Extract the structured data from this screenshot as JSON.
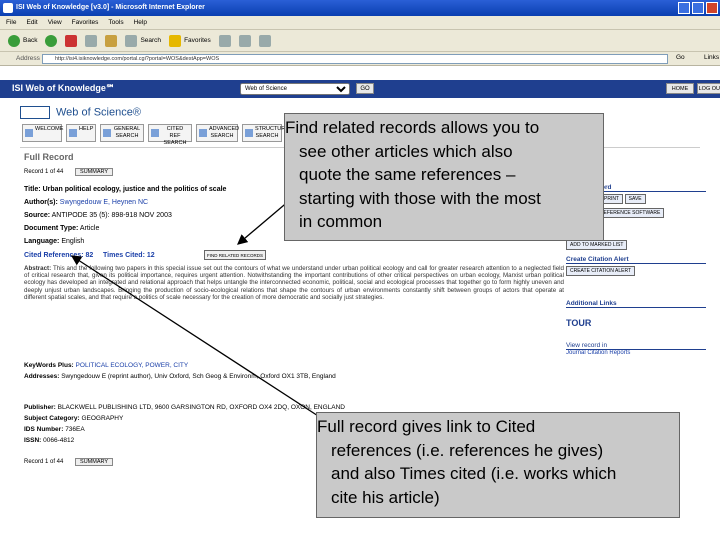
{
  "window": {
    "title": "ISI Web of Knowledge [v3.0] - Microsoft Internet Explorer"
  },
  "menubar": {
    "items": [
      "File",
      "Edit",
      "View",
      "Favorites",
      "Tools",
      "Help"
    ]
  },
  "toolbar": {
    "back": "Back",
    "search": "Search",
    "favorites": "Favorites"
  },
  "addressbar": {
    "label": "Address",
    "url": "http://isi4.isiknowledge.com/portal.cgi?portal=WOS&destApp=WOS",
    "go": "Go",
    "links": "Links"
  },
  "isi": {
    "brand": "ISI Web of Knowledge℠",
    "db_selected": "Web of Science",
    "go": "GO",
    "home": "HOME",
    "logout": "LOG OUT"
  },
  "wos": {
    "logo_text": "Web of Science®",
    "nav": [
      "WELCOME",
      "HELP",
      "GENERAL SEARCH",
      "CITED REF SEARCH",
      "ADVANCED SEARCH",
      "STRUCTURE SEARCH"
    ]
  },
  "record": {
    "section_title": "Full Record",
    "pager_top": "Record 1 of 44",
    "pager_bottom": "Record 1 of 44",
    "summary_btn": "SUMMARY",
    "title_label": "Title:",
    "title": "Urban political ecology, justice and the politics of scale",
    "authors_label": "Author(s):",
    "authors": "Swyngedouw E, Heynen NC",
    "source_label": "Source:",
    "source": "ANTIPODE 35 (5): 898-918 NOV 2003",
    "doctype_label": "Document Type:",
    "doctype": "Article",
    "language_label": "Language:",
    "language": "English",
    "cited_refs_label": "Cited References:",
    "cited_refs": "82",
    "times_cited_label": "Times Cited:",
    "times_cited": "12",
    "find_related_btn": "FIND RELATED RECORDS",
    "abstract_label": "Abstract:",
    "abstract": "This and the following two papers in this special issue set out the contours of what we understand under urban political ecology and call for greater research attention to a neglected field of critical research that, given its political importance, requires urgent attention. Notwithstanding the important contributions of other critical perspectives on urban ecology, Marxist urban political ecology has developed an integrated and relational approach that helps untangle the interconnected economic, political, social and ecological processes that together go to form highly uneven and deeply unjust urban landscapes. Bringing the production of socio-ecological relations that shape the contours of urban environments constantly shift between groups of actors that operate at different spatial scales, and that require a politics of scale necessary for the creation of more democratic and socially just strategies.",
    "keywords_label": "KeyWords Plus:",
    "keywords": "POLITICAL ECOLOGY, POWER, CITY",
    "addresses_label": "Addresses:",
    "addresses": "Swyngedouw E (reprint author), Univ Oxford, Sch Geog & Environm, Oxford OX1 3TB, England",
    "publisher_label": "Publisher:",
    "publisher": "BLACKWELL PUBLISHING LTD, 9600 GARSINGTON RD, OXFORD OX4 2DQ, OXON, ENGLAND",
    "subject_label": "Subject Category:",
    "subject": "GEOGRAPHY",
    "ids_label": "IDS Number:",
    "ids": "736EA",
    "issn_label": "ISSN:",
    "issn": "0066-4812"
  },
  "sidebar": {
    "output_head": "Output Record",
    "print_btn": "FORMAT FOR PRINT",
    "save_btn": "SAVE",
    "export_btn": "EXPORT TO REFERENCE SOFTWARE",
    "add_marked": "ADD TO MARKED LIST",
    "citation_head": "Create Citation Alert",
    "citation_btn": "CREATE CITATION ALERT",
    "fulltext_head": "Additional Links",
    "tour": "TOUR",
    "view_head": "View record in",
    "view_link": "Journal Citation Reports"
  },
  "callouts": {
    "top": {
      "lines": [
        "Find related records allows you to",
        "see other articles which also",
        "quote the same references –",
        "starting with those with the most",
        "in common"
      ]
    },
    "bottom": {
      "lines": [
        "Full record gives link to Cited",
        "references (i.e. references he gives)",
        "and also Times cited (i.e. works which",
        "cite his article)"
      ]
    }
  }
}
